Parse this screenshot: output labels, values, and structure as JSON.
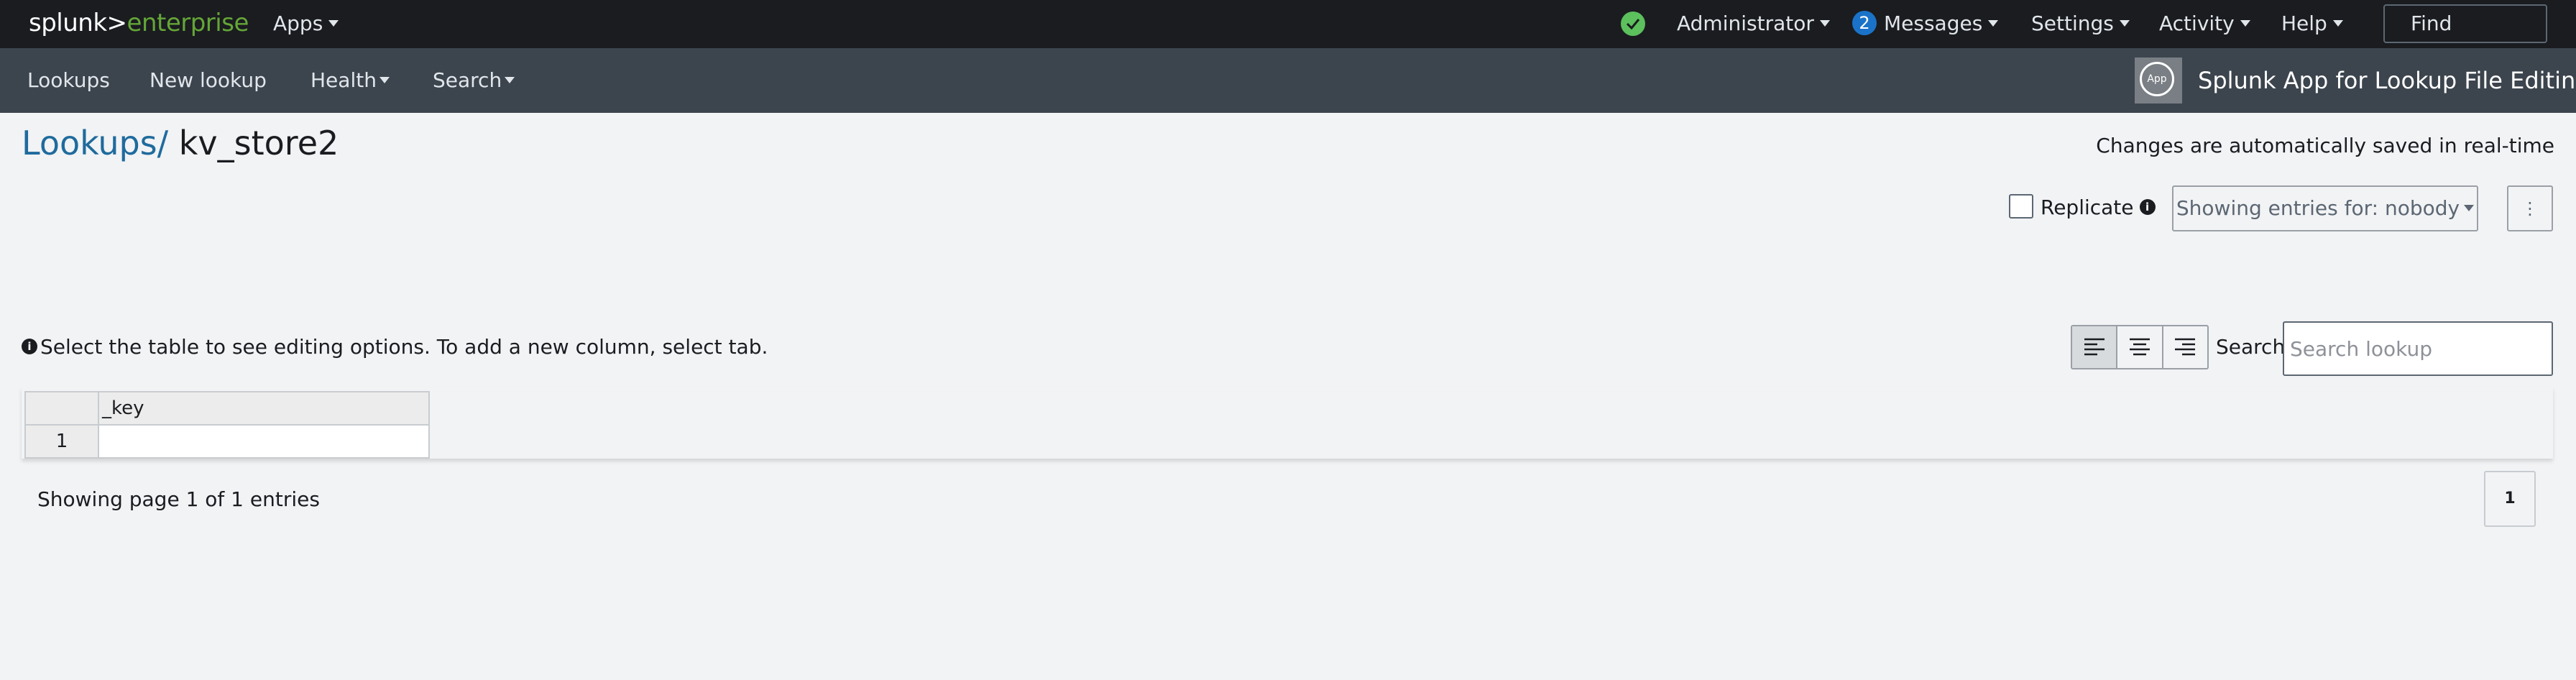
{
  "topbar": {
    "logo_splunk": "splunk>",
    "logo_enterprise": "enterprise",
    "apps": "Apps",
    "status_icon": "check-circle-icon",
    "user": "Administrator",
    "messages_count": "2",
    "messages": "Messages",
    "settings": "Settings",
    "activity": "Activity",
    "help": "Help",
    "find": "Find"
  },
  "appbar": {
    "nav": [
      "Lookups",
      "New lookup",
      "Health",
      "Search"
    ],
    "app_icon_label": "App",
    "app_title": "Splunk App for Lookup File Editing"
  },
  "breadcrumb": {
    "parent": "Lookups/",
    "current": "kv_store2"
  },
  "autosave_note": "Changes are automatically saved in real-time",
  "controls": {
    "replicate_label": "Replicate",
    "owner_button": "Showing entries for: nobody",
    "more_icon": "vertical-ellipsis-icon"
  },
  "hint": "Select the table to see editing options. To add a new column, select tab.",
  "search": {
    "label": "Search:",
    "placeholder": "Search lookup"
  },
  "table": {
    "columns": [
      "_key"
    ],
    "rows": [
      {
        "row_number": "1",
        "cells": [
          ""
        ]
      }
    ]
  },
  "footer": {
    "page_info": "Showing page 1 of 1 entries",
    "page_button": "1"
  }
}
